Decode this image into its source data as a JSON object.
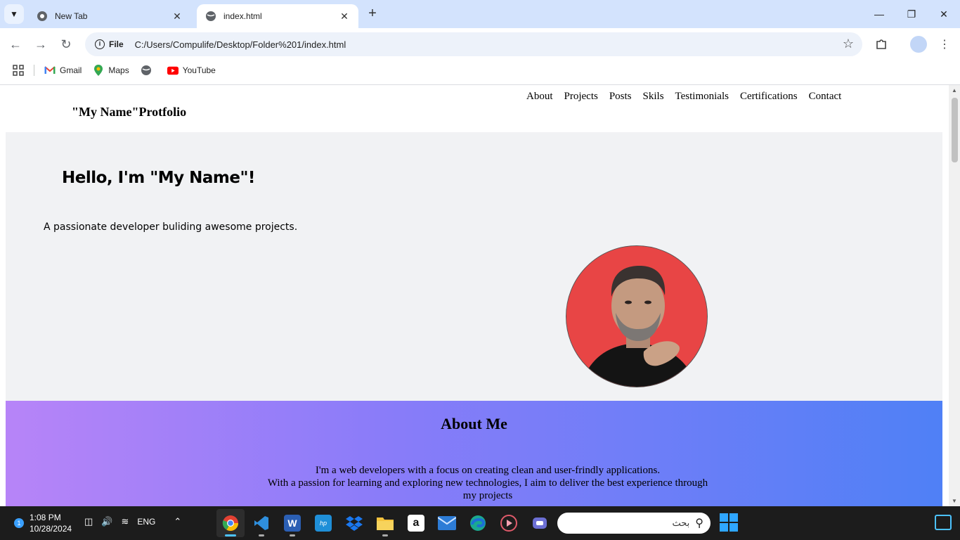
{
  "browser": {
    "tabs": [
      {
        "title": "New Tab",
        "favicon": "chrome-icon"
      },
      {
        "title": "index.html",
        "favicon": "globe-icon"
      }
    ],
    "address": {
      "chip_label": "File",
      "url": "C:/Users/Compulife/Desktop/Folder%201/index.html"
    },
    "bookmarks": [
      {
        "label": "Gmail",
        "icon": "gmail-icon"
      },
      {
        "label": "Maps",
        "icon": "maps-icon"
      },
      {
        "label": "",
        "icon": "globe-icon"
      },
      {
        "label": "YouTube",
        "icon": "youtube-icon"
      }
    ]
  },
  "site": {
    "logo": "\"My Name\"Protfolio",
    "nav": [
      "About",
      "Projects",
      "Posts",
      "Skils",
      "Testimonials",
      "Certifications",
      "Contact"
    ],
    "hero": {
      "heading": "Hello, I'm \"My Name\"!",
      "tagline": "A passionate developer buliding awesome projects."
    },
    "about": {
      "title": "About Me",
      "line1": "I'm a web developers with a focus on creating clean and user-frindly applications.",
      "line2": "With a passion for learning and exploring new technologies, I aim to deliver the best experience through my projects"
    }
  },
  "taskbar": {
    "notification_count": "1",
    "time": "1:08 PM",
    "date": "10/28/2024",
    "language": "ENG",
    "search_placeholder": "بحث",
    "apps": [
      {
        "name": "chrome",
        "color": "#e34133"
      },
      {
        "name": "vscode",
        "color": "#2f8fdd"
      },
      {
        "name": "word",
        "color": "#2b5fb4"
      },
      {
        "name": "myhp",
        "color": "#1f8fd8"
      },
      {
        "name": "dropbox",
        "color": "#1a78f0"
      },
      {
        "name": "file-explorer",
        "color": "#f4c23d"
      },
      {
        "name": "amazon",
        "color": "#ffffff"
      },
      {
        "name": "mail",
        "color": "#2d7cd6"
      },
      {
        "name": "edge",
        "color": "#1ba98f"
      },
      {
        "name": "media-player",
        "color": "#e05a6a"
      },
      {
        "name": "teams",
        "color": "#6c6fd4"
      }
    ]
  },
  "colors": {
    "tabstrip": "#d3e3fd",
    "hero_bg": "#f1f2f4",
    "about_gradient_start": "#b784f8",
    "about_gradient_end": "#4f80f6",
    "taskbar": "#1c1c1c"
  }
}
